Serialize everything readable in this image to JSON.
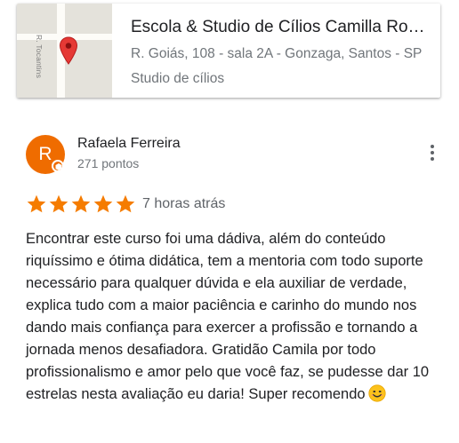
{
  "place": {
    "name": "Escola & Studio de Cílios Camilla Rocha",
    "address": "R. Goiás, 108 - sala 2A - Gonzaga, Santos - SP",
    "category": "Studio de cílios",
    "map_street_label": "R. Tocantins",
    "pin_color": "#e53935"
  },
  "review": {
    "avatar_initial": "R",
    "avatar_color": "#ef6c00",
    "reviewer_name": "Rafaela Ferreira",
    "reviewer_points": "271 pontos",
    "rating": 5,
    "max_rating": 5,
    "star_color": "#f57c00",
    "time_ago": "7 horas atrás",
    "text": "Encontrar este curso foi uma dádiva, além do conteúdo riquíssimo e ótima didática, tem a mentoria com todo suporte necessário para qualquer dúvida e ela auxiliar de verdade, explica tudo com a maior paciência e carinho do mundo nos dando mais confiança para exercer a profissão e tornando a jornada menos desafiadora. Gratidão Camila por todo profissionalismo e amor pelo que você faz, se pudesse dar 10 estrelas nesta avaliação eu daria! Super recomendo",
    "emoji": "smiling-face-emoji"
  }
}
